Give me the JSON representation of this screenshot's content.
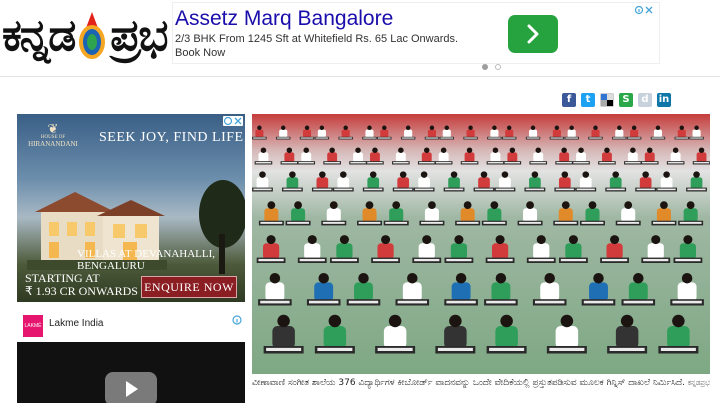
{
  "logo": {
    "text_left": "ಕನ್ನಡ",
    "text_right": "ಪ್ರಭ"
  },
  "top_ad": {
    "title": "Assetz Marq Bangalore",
    "description": "2/3 BHK From 1245 Sft at Whitefield Rs. 65 Lac Onwards. Book Now",
    "go_icon": "chevron-right-icon",
    "dots_active": 1,
    "dots_total": 2
  },
  "share_icons": [
    "facebook-icon",
    "twitter-icon",
    "delicious-icon",
    "stumbleupon-icon",
    "digg-icon",
    "linkedin-icon"
  ],
  "side_ad": {
    "brand_line1": "HOUSE OF",
    "brand_line2": "HIRANANDANI",
    "slogan": "SEEK JOY, FIND LIFE",
    "villas": "VILLAS AT DEVANAHALLI, BENGALURU",
    "starting": "STARTING AT",
    "price": "₹ 1.93 CR ONWARDS",
    "enquire": "ENQUIRE NOW"
  },
  "video_ad": {
    "advertiser": "Lakme India",
    "logo_text": "LAKMĒ"
  },
  "article": {
    "caption": "ವೀಣಾವಾಣಿ ಸಂಗೀತ ಶಾಲೆಯ 376 ವಿದ್ಯಾರ್ಥಿಗಳ ಕೀಬೋರ್ಡ್ ವಾದನವನ್ನು ಒಂದೇ ವೇದಿಕೆಯಲ್ಲಿ ಪ್ರಸ್ತುತಪಡಿಸುವ ಮೂಲಕ ಗಿನ್ನಿಸ್ ದಾಖಲೆ ನಿರ್ಮಿಸಿದೆ.",
    "credit": "ಕನ್ನಡಪ್ರಭ"
  },
  "colors": {
    "facebook": "#3b5998",
    "twitter": "#1da1f2",
    "linkedin": "#0e76a8",
    "stumble": "#2ba84a",
    "ad_title": "#1a0dab",
    "go_button": "#26a33e",
    "enquire": "#8b1e22"
  }
}
